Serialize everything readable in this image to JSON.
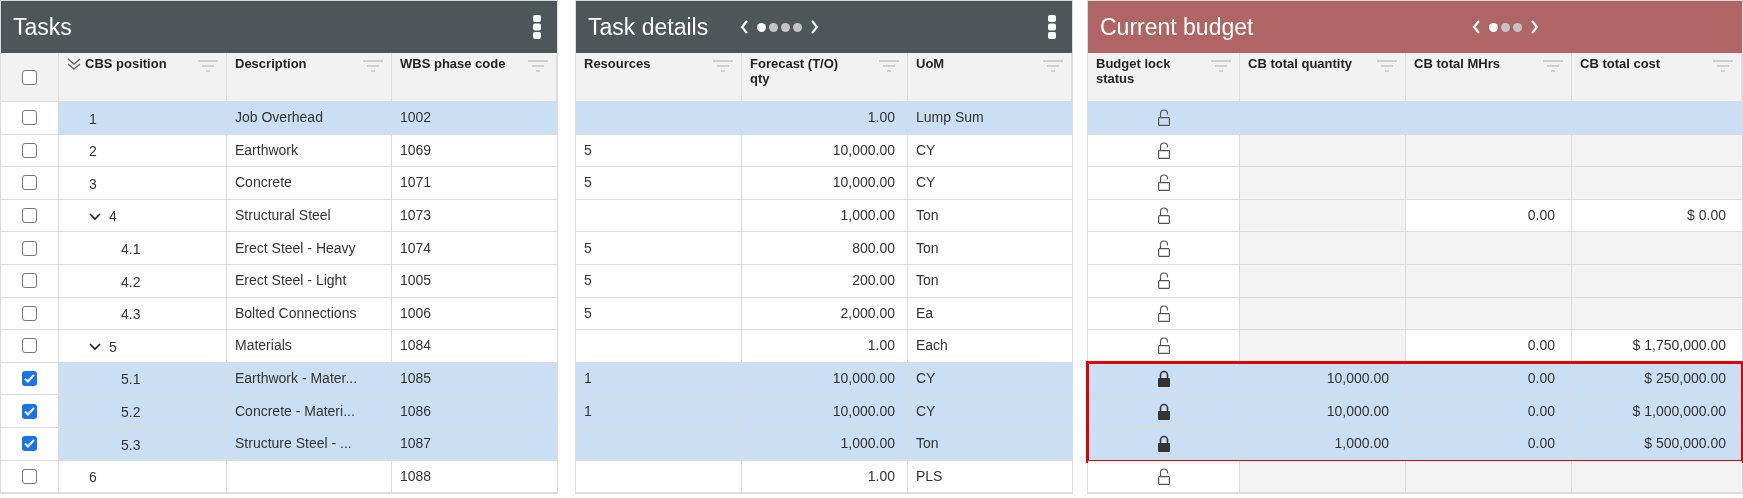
{
  "tasks": {
    "title": "Tasks",
    "select_all": {
      "checked": false
    },
    "columns": [
      "CBS position",
      "Description",
      "WBS phase code"
    ],
    "rows": [
      {
        "cbs": "1",
        "description": "Job Overhead",
        "wbs": "1002",
        "checked": false,
        "selected": true
      },
      {
        "cbs": "2",
        "description": "Earthwork",
        "wbs": "1069",
        "checked": false,
        "selected": false
      },
      {
        "cbs": "3",
        "description": "Concrete",
        "wbs": "1071",
        "checked": false,
        "selected": false
      },
      {
        "cbs": "4",
        "description": "Structural Steel",
        "wbs": "1073",
        "checked": false,
        "selected": false,
        "expanded": true,
        "children": [
          {
            "cbs": "4.1",
            "description": "Erect Steel - Heavy",
            "wbs": "1074",
            "checked": false,
            "selected": false
          },
          {
            "cbs": "4.2",
            "description": "Erect Steel - Light",
            "wbs": "1005",
            "checked": false,
            "selected": false
          },
          {
            "cbs": "4.3",
            "description": "Bolted Connections",
            "wbs": "1006",
            "checked": false,
            "selected": false
          }
        ]
      },
      {
        "cbs": "5",
        "description": "Materials",
        "wbs": "1084",
        "checked": false,
        "selected": false,
        "expanded": true,
        "children": [
          {
            "cbs": "5.1",
            "description": "Earthwork - Mater...",
            "wbs": "1085",
            "checked": true,
            "selected": true
          },
          {
            "cbs": "5.2",
            "description": "Concrete - Materi...",
            "wbs": "1086",
            "checked": true,
            "selected": true
          },
          {
            "cbs": "5.3",
            "description": "Structure Steel - ...",
            "wbs": "1087",
            "checked": true,
            "selected": true
          }
        ]
      },
      {
        "cbs": "6",
        "wbs": "1088",
        "checked": false,
        "selected": false
      }
    ]
  },
  "task_details": {
    "title": "Task details",
    "pager": [
      {
        "selected": true
      },
      {
        "selected": false
      },
      {
        "selected": false
      },
      {
        "selected": false
      }
    ],
    "columns": [
      "Resources",
      "Forecast (T/O) qty",
      "UoM"
    ],
    "rows": [
      {
        "forecast": "1.00",
        "uom": "Lump Sum",
        "selected": true
      },
      {
        "resources": "5",
        "forecast": "10,000.00",
        "uom": "CY",
        "selected": false
      },
      {
        "resources": "5",
        "forecast": "10,000.00",
        "uom": "CY",
        "selected": false
      },
      {
        "forecast": "1,000.00",
        "uom": "Ton",
        "selected": false
      },
      {
        "resources": "5",
        "forecast": "800.00",
        "uom": "Ton",
        "selected": false
      },
      {
        "resources": "5",
        "forecast": "200.00",
        "uom": "Ton",
        "selected": false
      },
      {
        "resources": "5",
        "forecast": "2,000.00",
        "uom": "Ea",
        "selected": false
      },
      {
        "forecast": "1.00",
        "uom": "Each",
        "selected": false
      },
      {
        "resources": "1",
        "forecast": "10,000.00",
        "uom": "CY",
        "selected": true
      },
      {
        "resources": "1",
        "forecast": "10,000.00",
        "uom": "CY",
        "selected": true
      },
      {
        "forecast": "1,000.00",
        "uom": "Ton",
        "selected": true
      },
      {
        "forecast": "1.00",
        "uom": "PLS",
        "selected": false
      }
    ]
  },
  "current_budget": {
    "title": "Current budget",
    "pager": [
      {
        "selected": true
      },
      {
        "selected": false
      },
      {
        "selected": false
      }
    ],
    "columns": [
      "Budget lock status",
      "CB total quantity",
      "CB total MHrs",
      "CB total cost"
    ],
    "rows": [
      {
        "locked": false,
        "selected": true,
        "outlined": false
      },
      {
        "locked": false,
        "selected": false,
        "outlined": false
      },
      {
        "locked": false,
        "selected": false,
        "outlined": false
      },
      {
        "locked": false,
        "selected": false,
        "outlined": false,
        "mhrs": "0.00",
        "cost": "$ 0.00"
      },
      {
        "locked": false,
        "selected": false,
        "outlined": false
      },
      {
        "locked": false,
        "selected": false,
        "outlined": false
      },
      {
        "locked": false,
        "selected": false,
        "outlined": false
      },
      {
        "locked": false,
        "selected": false,
        "outlined": false,
        "mhrs": "0.00",
        "cost": "$ 1,750,000.00"
      },
      {
        "locked": true,
        "selected": true,
        "outlined": true,
        "quantity": "10,000.00",
        "mhrs": "0.00",
        "cost": "$ 250,000.00"
      },
      {
        "locked": true,
        "selected": true,
        "outlined": true,
        "quantity": "10,000.00",
        "mhrs": "0.00",
        "cost": "$ 1,000,000.00"
      },
      {
        "locked": true,
        "selected": true,
        "outlined": true,
        "quantity": "1,000.00",
        "mhrs": "0.00",
        "cost": "$ 500,000.00"
      },
      {
        "locked": false,
        "selected": false,
        "outlined": false
      }
    ]
  }
}
